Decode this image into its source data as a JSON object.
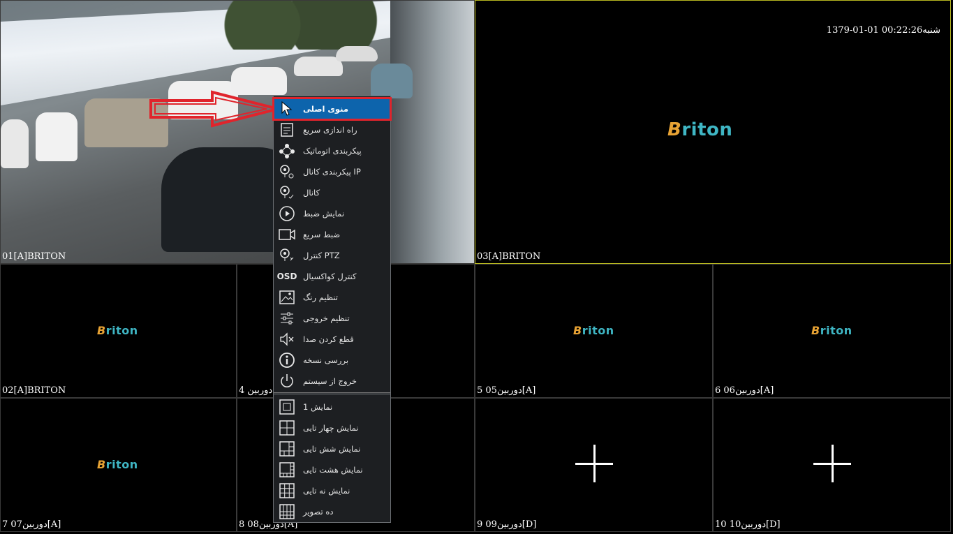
{
  "timestamp": "1379-01-01 00:22:26شنبه",
  "logo": {
    "first": "B",
    "rest": "riton"
  },
  "tiles": {
    "t01": {
      "label": "01[A]BRITON"
    },
    "t03": {
      "label": "03[A]BRITON"
    },
    "t02": {
      "label": "02[A]BRITON"
    },
    "t04": {
      "label": "4 دوربین"
    },
    "t05": {
      "label": "5 دوربین05[A]"
    },
    "t06": {
      "label": "6 دوربین06[A]"
    },
    "t07": {
      "label": "7 دوربین07[A]"
    },
    "t08": {
      "label": "8 دوربین08[A]"
    },
    "t09": {
      "label": "9 دوربین09[D]"
    },
    "t10": {
      "label": "10 دوربین10[D]"
    }
  },
  "menu": {
    "items": [
      {
        "label": "منوی اصلی",
        "icon": "cursor-icon"
      },
      {
        "label": "راه اندازی سریع",
        "icon": "document-icon"
      },
      {
        "label": "پیکربندی اتوماتیک",
        "icon": "network-icon"
      },
      {
        "label": "پیکربندی کانال IP",
        "icon": "camera-settings-icon"
      },
      {
        "label": "کانال",
        "icon": "camera-check-icon"
      },
      {
        "label": "نمایش ضبط",
        "icon": "play-icon"
      },
      {
        "label": "ضبط سریع",
        "icon": "video-icon"
      },
      {
        "label": "کنترل PTZ",
        "icon": "ptz-camera-icon"
      },
      {
        "label": "کنترل کواکسیال",
        "icon": "osd-icon",
        "icon_text": "OSD"
      },
      {
        "label": "تنظیم رنگ",
        "icon": "image-icon"
      },
      {
        "label": "تنظیم خروجی",
        "icon": "sliders-icon"
      },
      {
        "label": "قطع کردن صدا",
        "icon": "mute-icon"
      },
      {
        "label": "بررسی نسخه",
        "icon": "info-icon"
      },
      {
        "label": "خروج از سیستم",
        "icon": "power-icon"
      }
    ],
    "layouts": [
      {
        "label": "نمایش 1",
        "icon": "layout-1-icon"
      },
      {
        "label": "نمایش چهار تایی",
        "icon": "layout-4-icon"
      },
      {
        "label": "نمایش شش تایی",
        "icon": "layout-6-icon"
      },
      {
        "label": "نمایش هشت تایی",
        "icon": "layout-8-icon"
      },
      {
        "label": "نمایش نه تایی",
        "icon": "layout-9-icon"
      },
      {
        "label": "ده تصویر",
        "icon": "layout-10-icon"
      }
    ]
  }
}
